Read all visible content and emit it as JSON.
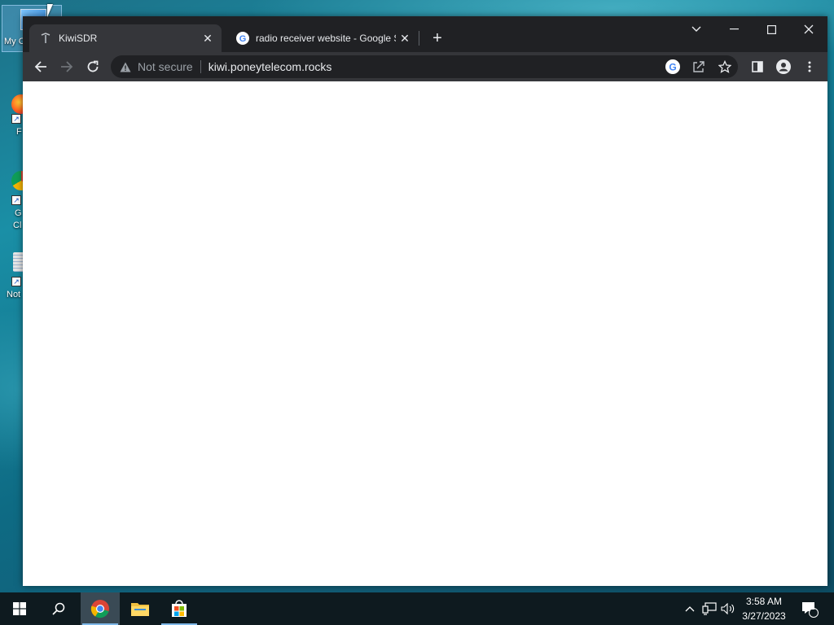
{
  "desktop": {
    "icons": [
      {
        "label": "My C",
        "icon": "computer-icon"
      },
      {
        "label": "F",
        "icon": "firefox-icon"
      },
      {
        "label_line1": "G",
        "label_line2": "Cl",
        "icon": "chrome-icon"
      },
      {
        "label": "Not",
        "icon": "notepad-icon"
      }
    ]
  },
  "browser": {
    "tabs": [
      {
        "title": "KiwiSDR",
        "active": true,
        "favicon": "kiwisdr-favicon"
      },
      {
        "title": "radio receiver website - Google S",
        "active": false,
        "favicon": "google-favicon"
      }
    ],
    "close_glyph": "✕",
    "new_tab_glyph": "+",
    "address": {
      "security_label": "Not secure",
      "url": "kiwi.poneytelecom.rocks"
    }
  },
  "taskbar": {
    "time": "3:58 AM",
    "date": "3/27/2023",
    "notification_count": "1"
  },
  "colors": {
    "titlebar": "#202124",
    "toolbar": "#35363a",
    "taskbar": "#0e1a1f"
  }
}
